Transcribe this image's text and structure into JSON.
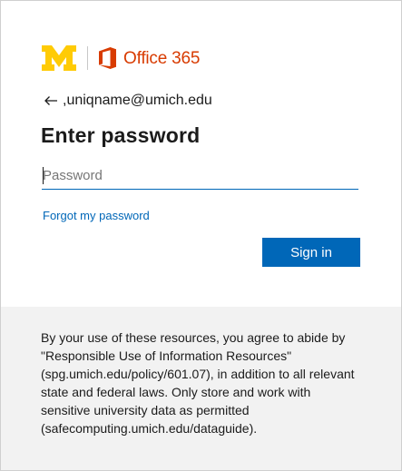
{
  "branding": {
    "office_label": "Office 365",
    "um_logo_icon": "block-m-logo",
    "office_icon": "office-logo-icon",
    "um_color": "#ffcb05",
    "office_color": "#d83b01"
  },
  "identity": {
    "back_icon": "back-arrow-icon",
    "email": ",uniqname@umich.edu"
  },
  "form": {
    "title": "Enter password",
    "password_placeholder": "Password",
    "password_value": "",
    "forgot_label": "Forgot my password",
    "signin_label": "Sign in",
    "accent_color": "#0067b8"
  },
  "footer": {
    "notice": "By your use of these resources, you agree to abide by \"Responsible Use of Information Resources\" (spg.umich.edu/policy/601.07), in addition to all relevant state and federal laws. Only store and work with sensitive university data as permitted (safecomputing.umich.edu/dataguide)."
  }
}
